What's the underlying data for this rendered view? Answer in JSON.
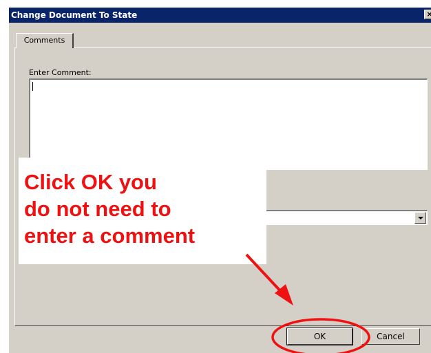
{
  "window": {
    "title": "Change Document To State",
    "close_glyph": "×"
  },
  "tabs": [
    {
      "label": "Comments"
    }
  ],
  "comments": {
    "enter_comment_label": "Enter Comment:",
    "comment_value": "",
    "state_value": ""
  },
  "buttons": {
    "ok_label": "OK",
    "cancel_label": "Cancel"
  },
  "annotation": {
    "lines": [
      "Click OK you",
      "do not need to",
      "enter a comment"
    ],
    "color": "#ee1111"
  },
  "colors": {
    "titlebar": "#0a246a",
    "dialog_face": "#d4d0c8"
  }
}
